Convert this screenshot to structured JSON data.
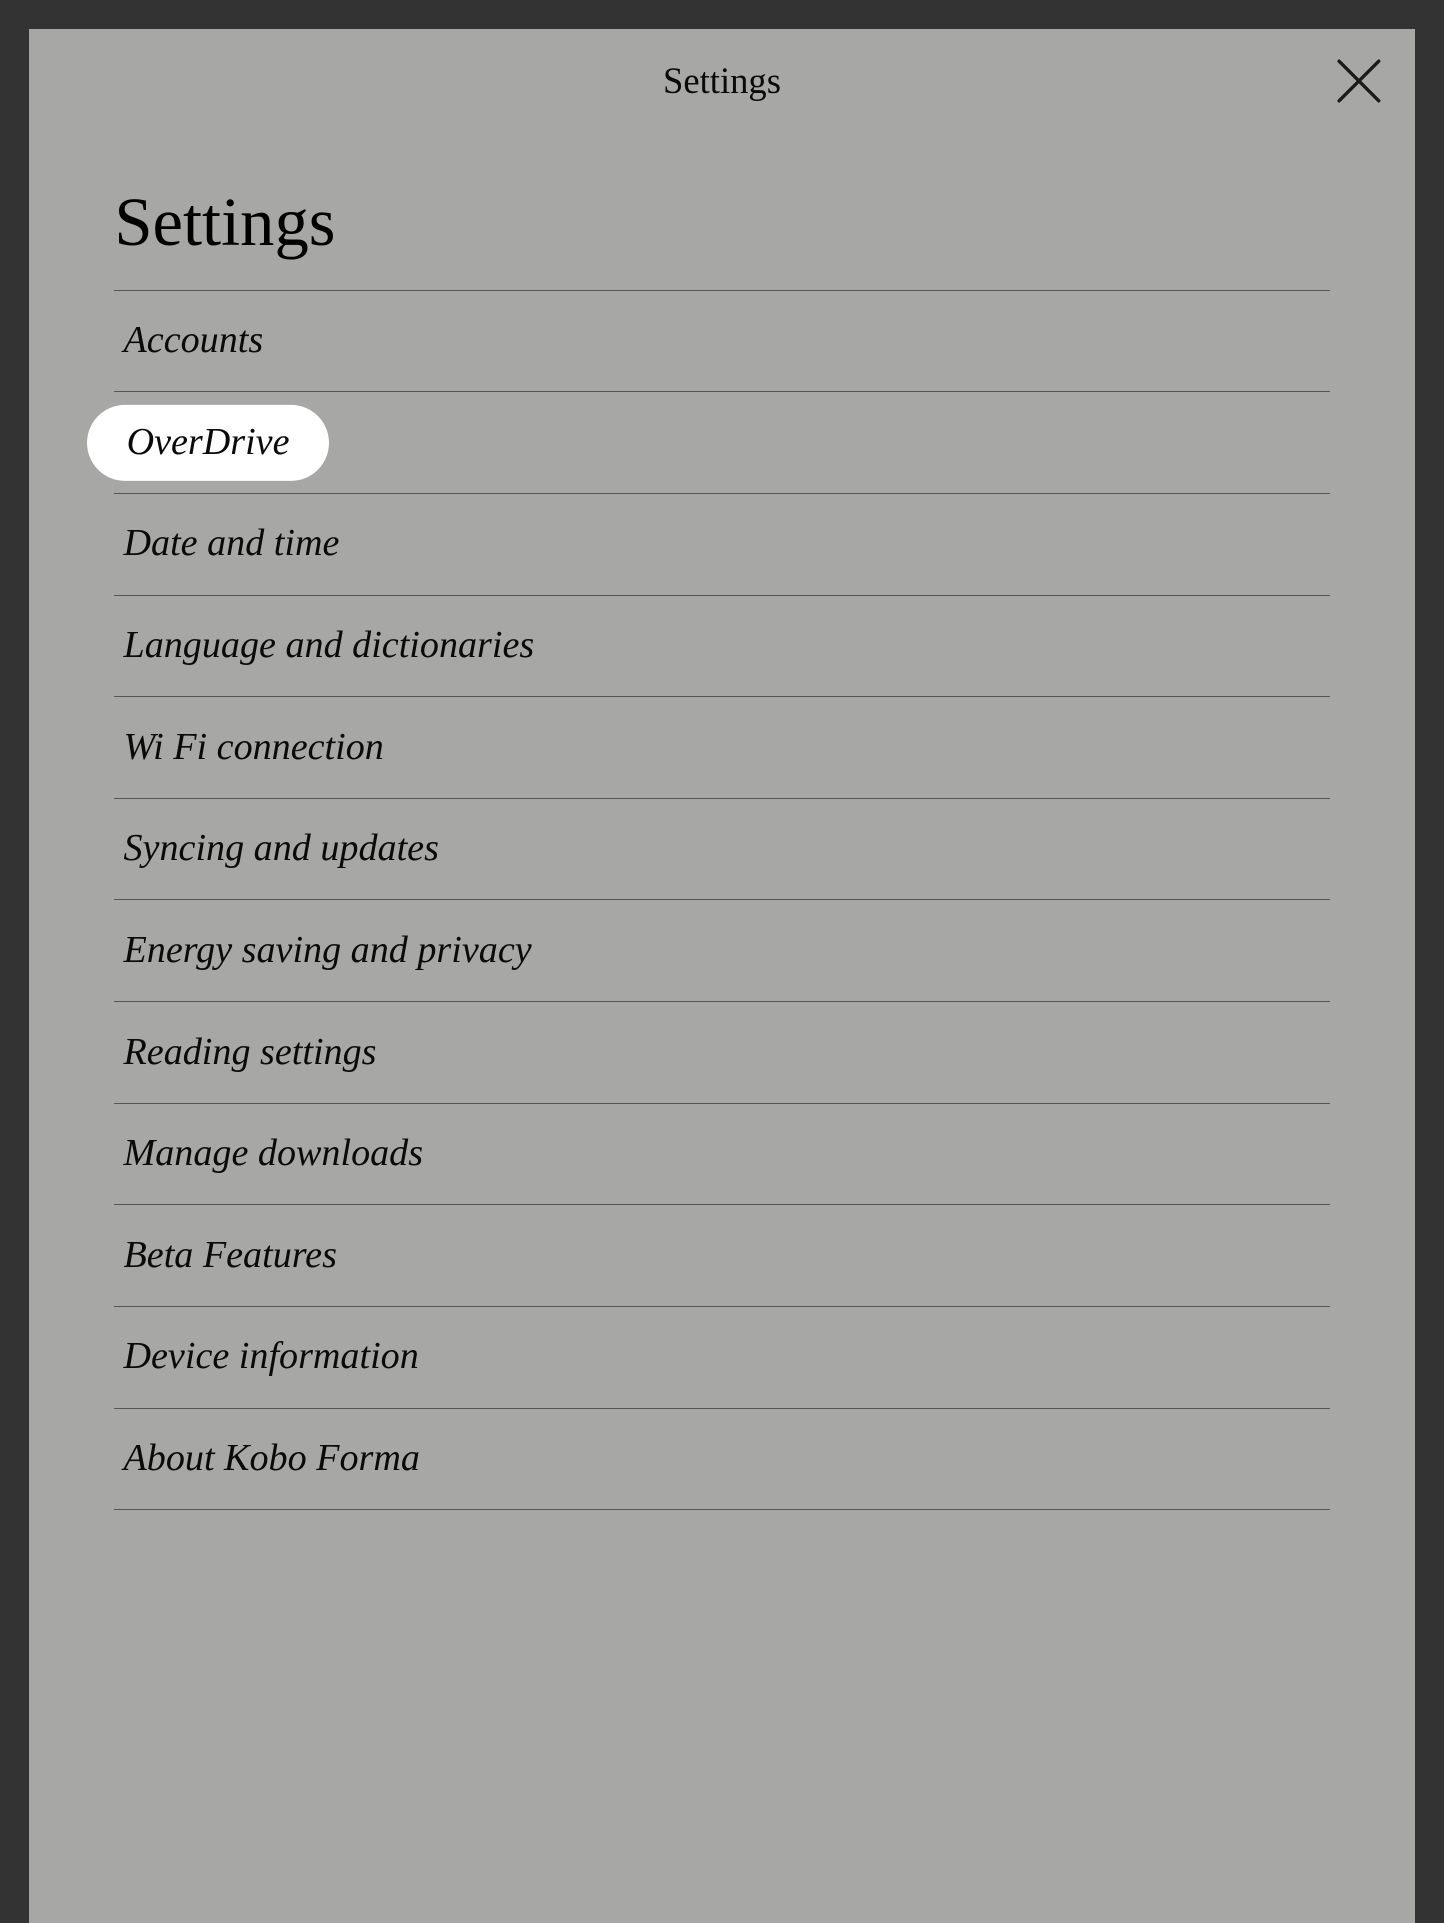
{
  "header": {
    "title": "Settings"
  },
  "page": {
    "title": "Settings"
  },
  "menu": {
    "highlighted_index": 1,
    "items": [
      {
        "label": "Accounts"
      },
      {
        "label": "OverDrive"
      },
      {
        "label": "Date and time"
      },
      {
        "label": "Language and dictionaries"
      },
      {
        "label": "Wi Fi connection"
      },
      {
        "label": "Syncing and updates"
      },
      {
        "label": "Energy saving and privacy"
      },
      {
        "label": "Reading settings"
      },
      {
        "label": "Manage downloads"
      },
      {
        "label": "Beta Features"
      },
      {
        "label": "Device information"
      },
      {
        "label": "About Kobo Forma"
      }
    ]
  }
}
